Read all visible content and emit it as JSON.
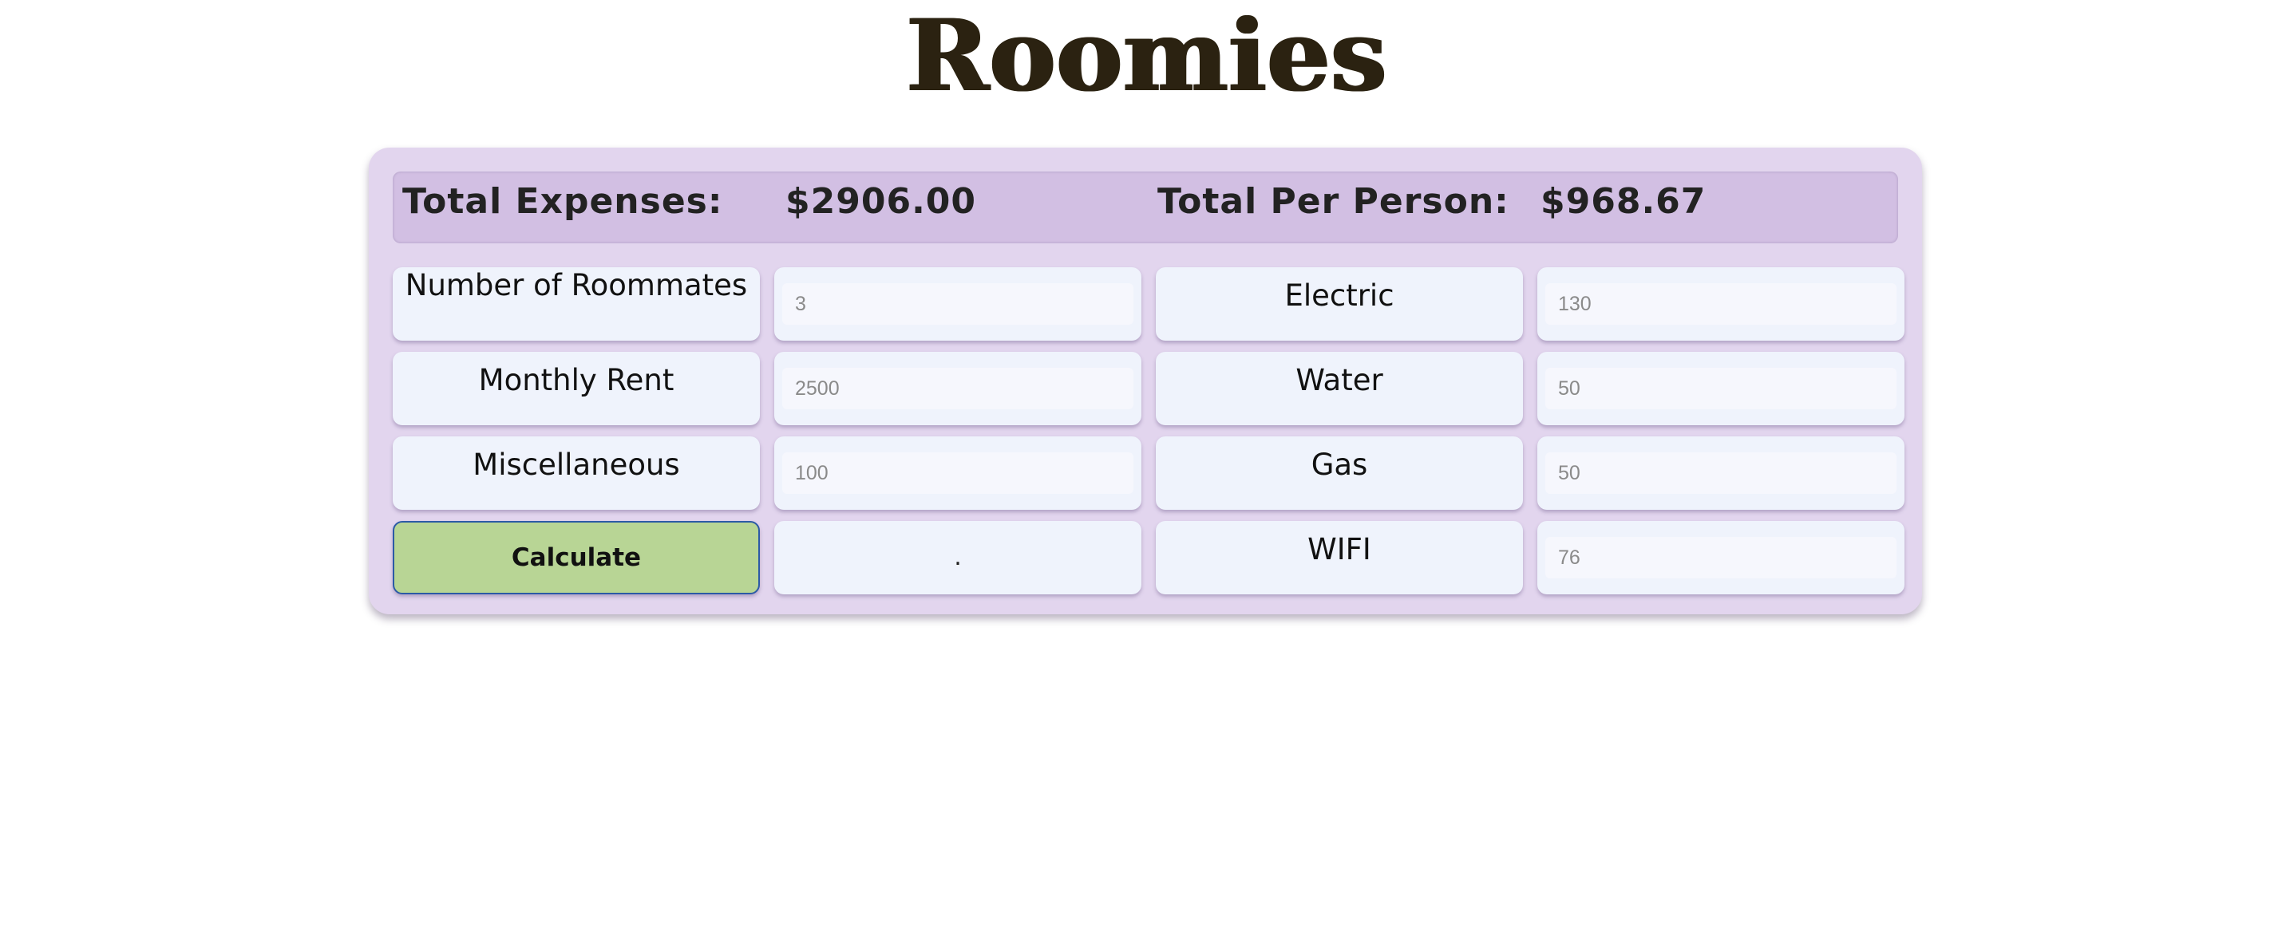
{
  "app": {
    "title": "Roomies"
  },
  "totals": {
    "expenses_label": "Total Expenses:",
    "expenses_value": "$2906.00",
    "per_person_label": "Total Per Person:",
    "per_person_value": "$968.67"
  },
  "fields": {
    "roommates": {
      "label": "Number of Roommates",
      "placeholder": "3"
    },
    "rent": {
      "label": "Monthly Rent",
      "placeholder": "2500"
    },
    "misc": {
      "label": "Miscellaneous",
      "placeholder": "100"
    },
    "electric": {
      "label": "Electric",
      "placeholder": "130"
    },
    "water": {
      "label": "Water",
      "placeholder": "50"
    },
    "gas": {
      "label": "Gas",
      "placeholder": "50"
    },
    "wifi": {
      "label": "WIFI",
      "placeholder": "76"
    }
  },
  "actions": {
    "calculate_label": "Calculate",
    "result_text": "."
  },
  "colors": {
    "panel": "#e2d5ee",
    "totals_bar": "#d2bfe3",
    "cell": "#eff3fc",
    "button": "#b8d595",
    "button_border": "#2c5aa6",
    "title": "#2b2211"
  }
}
